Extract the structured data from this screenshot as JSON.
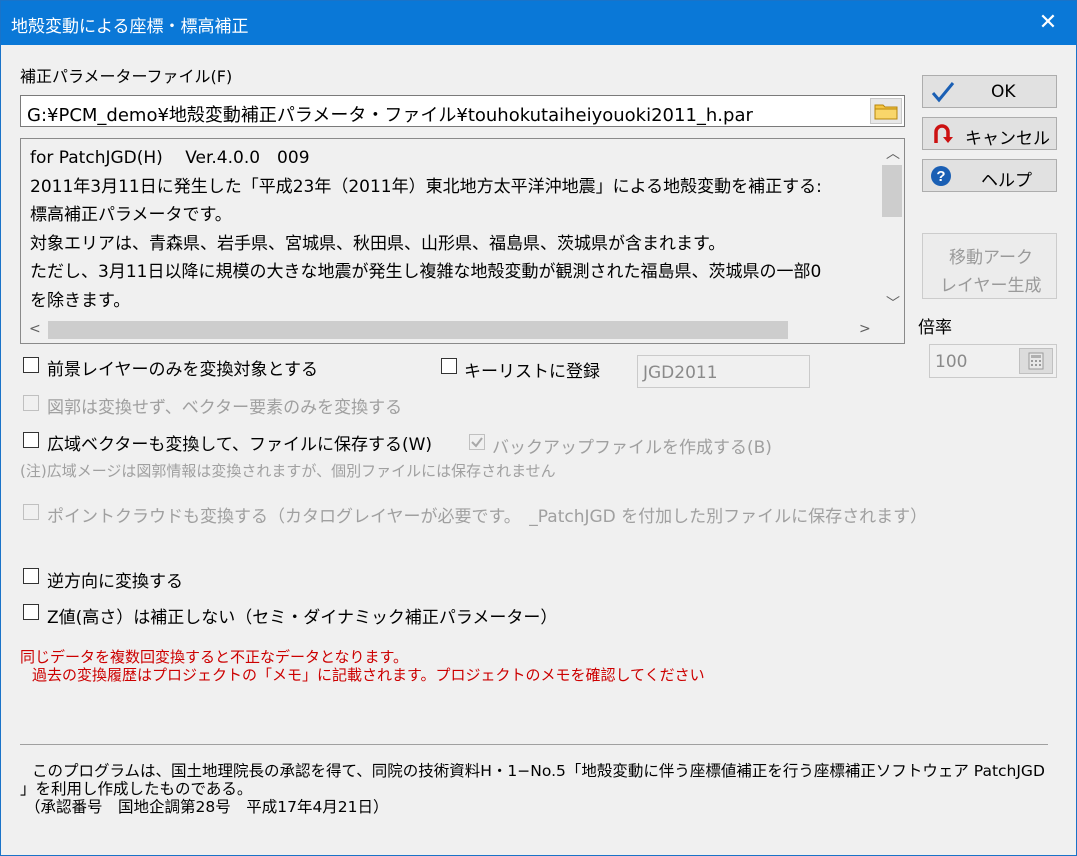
{
  "window": {
    "title": "地殻変動による座標・標高補正",
    "close_glyph": "✕"
  },
  "param_file": {
    "label": "補正パラメーターファイル(F)",
    "value": "G:¥PCM_demo¥地殻変動補正パラメータ・ファイル¥touhokutaiheiyouoki2011_h.par"
  },
  "memo": {
    "lines": [
      "for PatchJGD(H)　 Ver.4.0.0　009",
      "2011年3月11日に発生した「平成23年（2011年）東北地方太平洋沖地震」による地殻変動を補正する:",
      "標高補正パラメータです。",
      "対象エリアは、青森県、岩手県、宮城県、秋田県、山形県、福島県、茨城県が含まれます。",
      "ただし、3月11日以降に規模の大きな地震が発生し複雑な地殻変動が観測された福島県、茨城県の一部0",
      "を除きます。"
    ]
  },
  "buttons": {
    "ok": "OK",
    "cancel": "キャンセル",
    "help": "ヘルプ",
    "arc_line1": "移動アーク",
    "arc_line2": "レイヤー生成"
  },
  "scale": {
    "label": "倍率",
    "value": "100"
  },
  "options": {
    "foreground_only": "前景レイヤーのみを変換対象とする",
    "register_keylist": "キーリストに登録",
    "keylist_value": "JGD2011",
    "vector_only": "図郭は変換せず、ベクター要素のみを変換する",
    "wide_vector": "広域ベクターも変換して、ファイルに保存する(W)",
    "backup": "バックアップファイルを作成する(B)",
    "wide_note": "(注)広域メージは図郭情報は変換されますが、個別ファイルには保存されません",
    "pointcloud": "ポイントクラウドも変換する（カタログレイヤーが必要です。　_PatchJGD を付加した別ファイルに保存されます）",
    "reverse": "逆方向に変換する",
    "no_z": "Z値(高さ）は補正しない（セミ・ダイナミック補正パラメーター）"
  },
  "warnings": {
    "line1": "同じデータを複数回変換すると不正なデータとなります。",
    "line2": "過去の変換履歴はプロジェクトの「メモ」に記載されます。プロジェクトのメモを確認してください"
  },
  "footer": {
    "line1": "このプログラムは、国土地理院長の承認を得て、同院の技術資料H・1−No.5「地殻変動に伴う座標値補正を行う座標補正ソフトウェア PatchJGD",
    "line2": "」を利用し作成したものである。",
    "line3": "（承認番号　国地企調第28号　平成17年4月21日）"
  },
  "colors": {
    "titlebar": "#0a78d7",
    "warning": "#cc0000",
    "ok_check": "#1a5fb4",
    "cancel_icon": "#cc1111",
    "help_icon": "#1a5fb4"
  }
}
